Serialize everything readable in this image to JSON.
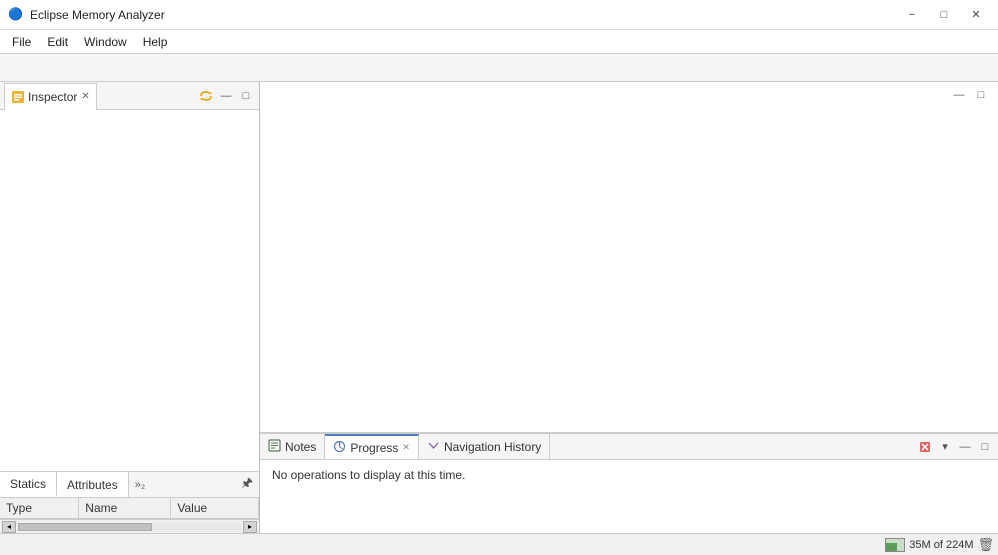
{
  "app": {
    "title": "Eclipse Memory Analyzer",
    "icon": "🔵"
  },
  "titlebar": {
    "minimize_label": "−",
    "maximize_label": "□",
    "close_label": "✕"
  },
  "menubar": {
    "items": [
      "File",
      "Edit",
      "Window",
      "Help"
    ]
  },
  "left_panel": {
    "tab_label": "Inspector",
    "tab_close": "✕",
    "action_sync": "↔",
    "action_minimize": "—",
    "action_maximize": "□"
  },
  "left_bottom_tabs": {
    "statics_label": "Statics",
    "attributes_label": "Attributes",
    "overflow_label": "»₂",
    "columns": [
      "Type",
      "Name",
      "Value"
    ]
  },
  "right_panel": {
    "minimize": "—",
    "maximize": "□"
  },
  "bottom_panel": {
    "tabs": [
      {
        "label": "Notes",
        "icon": "📋",
        "has_close": false
      },
      {
        "label": "Progress",
        "icon": "⚙",
        "has_close": true
      },
      {
        "label": "Navigation History",
        "icon": "🔀",
        "has_close": false
      }
    ],
    "active_tab": 1,
    "no_operations_text": "No operations to display at this time.",
    "actions": {
      "stop": "✕",
      "dropdown": "▾",
      "minimize": "—",
      "maximize": "□"
    }
  },
  "statusbar": {
    "memory_label": "35M of 224M"
  }
}
